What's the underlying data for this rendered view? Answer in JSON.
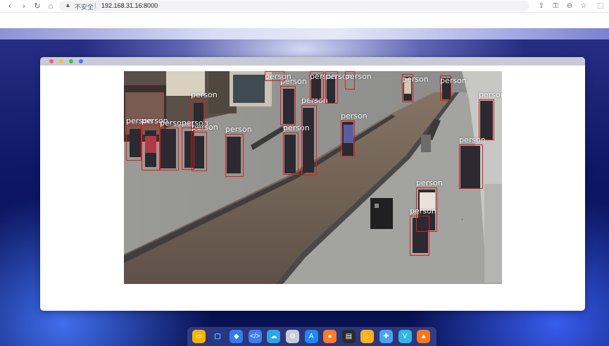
{
  "browser": {
    "insecure_label": "不安全",
    "separator": "|",
    "url": "192.168.31.16:8000",
    "nav": [
      {
        "name": "back-icon",
        "glyph": "‹"
      },
      {
        "name": "forward-icon",
        "glyph": "›"
      },
      {
        "name": "reload-icon",
        "glyph": "↻"
      },
      {
        "name": "home-icon",
        "glyph": "⌂"
      }
    ],
    "warning_glyph": "▲",
    "toolbar": [
      {
        "name": "share-icon",
        "glyph": "⇪"
      },
      {
        "name": "key-icon",
        "glyph": "⚿"
      },
      {
        "name": "zoom-icon",
        "glyph": "⊖"
      },
      {
        "name": "bookmark-star-icon",
        "glyph": "☆"
      },
      {
        "name": "extensions-icon",
        "glyph": "⬚"
      }
    ]
  },
  "window": {
    "traffic_lights": [
      "#ff5f57",
      "#febc2e",
      "#28c840",
      "#3b82f6"
    ]
  },
  "detections": {
    "label": "person",
    "box_color": "#e01b1b"
  },
  "dock": {
    "items": [
      {
        "name": "files-app-icon",
        "color": "#f5b400",
        "glyph": "▭"
      },
      {
        "name": "window-app-icon",
        "color": "#1f3b8c",
        "glyph": "▢"
      },
      {
        "name": "shield-app-icon",
        "color": "#2f7cf6",
        "glyph": "◆"
      },
      {
        "name": "code-app-icon",
        "color": "#3d7ef7",
        "glyph": "</>"
      },
      {
        "name": "cloud-app-icon",
        "color": "#2aa5e8",
        "glyph": "☁"
      },
      {
        "name": "settings-app-icon",
        "color": "#c9ccd6",
        "glyph": "⚙"
      },
      {
        "name": "app-store-icon",
        "color": "#1e88f5",
        "glyph": "A"
      },
      {
        "name": "lightbulb-app-icon",
        "color": "#ff7a2b",
        "glyph": "●"
      },
      {
        "name": "terminal-app-icon",
        "color": "#2a2a2a",
        "glyph": "▤"
      },
      {
        "name": "hand-app-icon",
        "color": "#ffb020",
        "glyph": "✋"
      },
      {
        "name": "puzzle-app-icon",
        "color": "#47a2f5",
        "glyph": "✚"
      },
      {
        "name": "vivaldi-app-icon",
        "color": "#2fb5e8",
        "glyph": "V"
      },
      {
        "name": "triangle-app-icon",
        "color": "#f5781e",
        "glyph": "▲"
      }
    ]
  }
}
